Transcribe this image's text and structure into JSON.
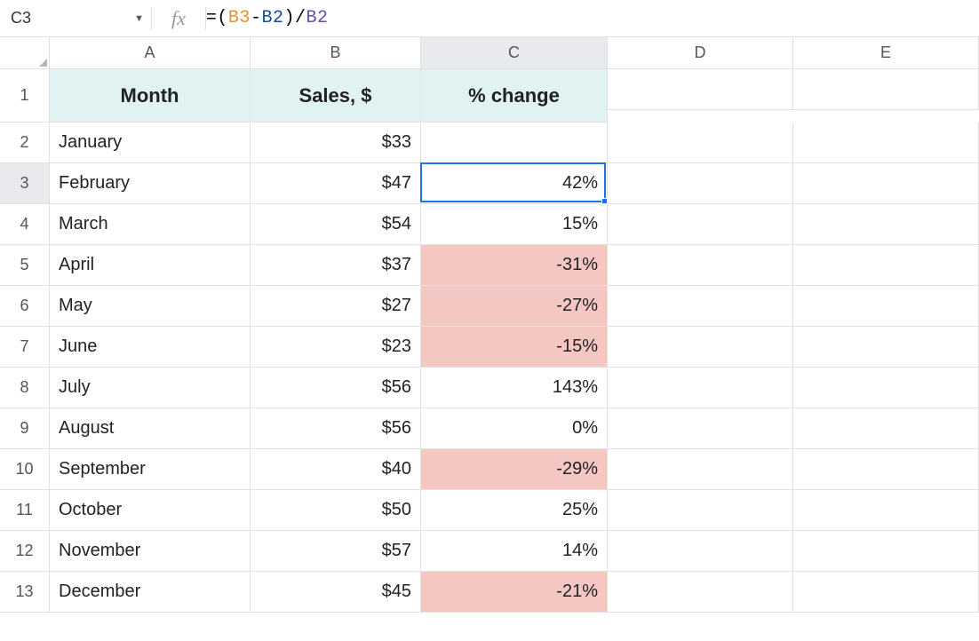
{
  "name_box": "C3",
  "fx_label": "fx",
  "formula_tokens": {
    "eq": "=",
    "lp": "(",
    "b3": "B3",
    "minus": "-",
    "b2_in": "B2",
    "rp": ")",
    "slash": "/",
    "b2_out": "B2"
  },
  "column_labels": [
    "A",
    "B",
    "C",
    "D",
    "E"
  ],
  "row_labels": [
    "1",
    "2",
    "3",
    "4",
    "5",
    "6",
    "7",
    "8",
    "9",
    "10",
    "11",
    "12",
    "13"
  ],
  "selected_cell": "C3",
  "headers": {
    "month": "Month",
    "sales": "Sales, $",
    "change": "% change"
  },
  "rows": [
    {
      "month": "January",
      "sales": "$33",
      "change": "",
      "neg": false
    },
    {
      "month": "February",
      "sales": "$47",
      "change": "42%",
      "neg": false
    },
    {
      "month": "March",
      "sales": "$54",
      "change": "15%",
      "neg": false
    },
    {
      "month": "April",
      "sales": "$37",
      "change": "-31%",
      "neg": true
    },
    {
      "month": "May",
      "sales": "$27",
      "change": "-27%",
      "neg": true
    },
    {
      "month": "June",
      "sales": "$23",
      "change": "-15%",
      "neg": true
    },
    {
      "month": "July",
      "sales": "$56",
      "change": "143%",
      "neg": false
    },
    {
      "month": "August",
      "sales": "$56",
      "change": "0%",
      "neg": false
    },
    {
      "month": "September",
      "sales": "$40",
      "change": "-29%",
      "neg": true
    },
    {
      "month": "October",
      "sales": "$50",
      "change": "25%",
      "neg": false
    },
    {
      "month": "November",
      "sales": "$57",
      "change": "14%",
      "neg": false
    },
    {
      "month": "December",
      "sales": "$45",
      "change": "-21%",
      "neg": true
    }
  ],
  "chart_data": {
    "type": "table",
    "columns": [
      "Month",
      "Sales, $",
      "% change"
    ],
    "data": [
      [
        "January",
        33,
        null
      ],
      [
        "February",
        47,
        0.42
      ],
      [
        "March",
        54,
        0.15
      ],
      [
        "April",
        37,
        -0.31
      ],
      [
        "May",
        27,
        -0.27
      ],
      [
        "June",
        23,
        -0.15
      ],
      [
        "July",
        56,
        1.43
      ],
      [
        "August",
        56,
        0.0
      ],
      [
        "September",
        40,
        -0.29
      ],
      [
        "October",
        50,
        0.25
      ],
      [
        "November",
        57,
        0.14
      ],
      [
        "December",
        45,
        -0.21
      ]
    ]
  }
}
